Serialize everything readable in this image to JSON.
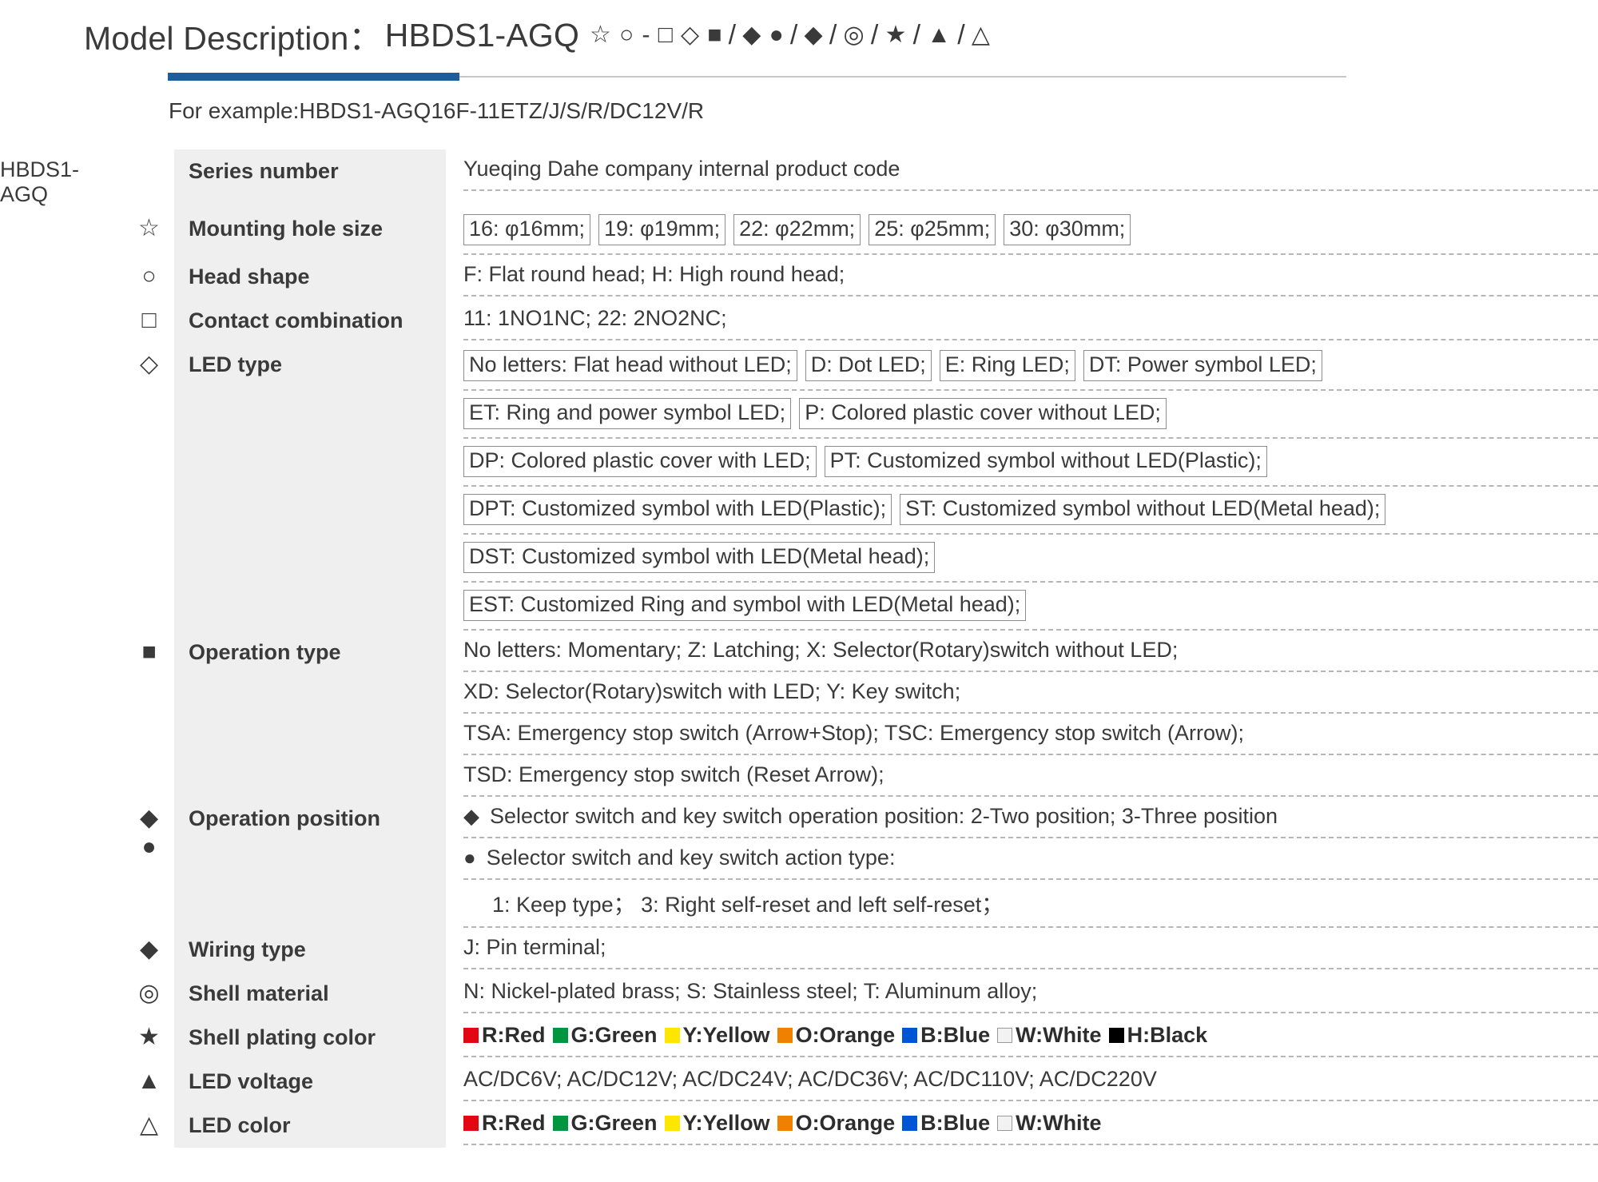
{
  "header": {
    "title_label": "Model Description：",
    "model": "HBDS1-AGQ",
    "symbol_sequence": [
      "☆",
      "○",
      "-",
      "□",
      "◇",
      "■",
      "/",
      "◆",
      "●",
      "/",
      "◆",
      "/",
      "◎",
      "/",
      "★",
      "/",
      "▲",
      "/",
      "△"
    ],
    "example": "For example:HBDS1-AGQ16F-11ETZ/J/S/R/DC12V/R",
    "accent_color": "#1d5d9b"
  },
  "table": {
    "series_code": "HBDS1-AGQ",
    "rows": [
      {
        "symbols": [],
        "label": "Series number",
        "lines": [
          {
            "boxed": false,
            "items": [
              "Yueqing Dahe company internal product code"
            ]
          }
        ]
      },
      {
        "symbols": [
          "☆"
        ],
        "label": "Mounting hole size",
        "lines": [
          {
            "boxed": true,
            "items": [
              "16: φ16mm;",
              "19: φ19mm;",
              "22: φ22mm;",
              "25: φ25mm;",
              "30: φ30mm;"
            ]
          }
        ]
      },
      {
        "symbols": [
          "○"
        ],
        "label": "Head  shape",
        "lines": [
          {
            "boxed": false,
            "items": [
              "F: Flat round head;   H: High round head;"
            ]
          }
        ]
      },
      {
        "symbols": [
          "□"
        ],
        "label": "Contact combination",
        "lines": [
          {
            "boxed": false,
            "items": [
              "11: 1NO1NC;   22: 2NO2NC;"
            ]
          }
        ]
      },
      {
        "symbols": [
          "◇"
        ],
        "label": "LED type",
        "lines": [
          {
            "boxed": true,
            "items": [
              "No letters: Flat head without LED;",
              "D: Dot LED;",
              "E: Ring LED;",
              "DT: Power symbol LED;"
            ]
          },
          {
            "boxed": true,
            "items": [
              "ET: Ring and power symbol LED;",
              "P: Colored plastic cover without LED;"
            ]
          },
          {
            "boxed": true,
            "items": [
              "DP: Colored plastic cover with LED;",
              "PT: Customized symbol without LED(Plastic);"
            ]
          },
          {
            "boxed": true,
            "items": [
              "DPT: Customized symbol with LED(Plastic);",
              "ST: Customized symbol without LED(Metal head);"
            ]
          },
          {
            "boxed": true,
            "items": [
              "DST: Customized symbol with LED(Metal head);"
            ]
          },
          {
            "boxed": true,
            "items": [
              "EST: Customized Ring and symbol with LED(Metal head);"
            ]
          }
        ]
      },
      {
        "symbols": [
          "■"
        ],
        "label": "Operation type",
        "lines": [
          {
            "boxed": false,
            "items": [
              "No letters: Momentary;   Z: Latching;   X: Selector(Rotary)switch without LED;"
            ]
          },
          {
            "boxed": false,
            "items": [
              "XD: Selector(Rotary)switch with  LED;   Y: Key switch;"
            ]
          },
          {
            "boxed": false,
            "items": [
              "TSA: Emergency stop switch (Arrow+Stop);   TSC: Emergency stop switch (Arrow);"
            ]
          },
          {
            "boxed": false,
            "items": [
              "TSD: Emergency stop switch (Reset Arrow);"
            ]
          }
        ]
      },
      {
        "symbols": [
          "◆",
          "●"
        ],
        "label": "Operation position",
        "lines": [
          {
            "boxed": false,
            "prefix": "◆",
            "items": [
              "Selector switch and key switch operation position: 2-Two position;   3-Three position"
            ]
          },
          {
            "boxed": false,
            "prefix": "●",
            "items": [
              "Selector switch and key switch action type:"
            ]
          },
          {
            "boxed": false,
            "indent": true,
            "items": [
              "1: Keep type；  3: Right self-reset and left self-reset；"
            ]
          }
        ]
      },
      {
        "symbols": [
          "◆"
        ],
        "label": "Wiring type",
        "lines": [
          {
            "boxed": false,
            "items": [
              "J: Pin terminal;"
            ]
          }
        ]
      },
      {
        "symbols": [
          "◎"
        ],
        "label": "Shell material",
        "lines": [
          {
            "boxed": false,
            "items": [
              "N: Nickel-plated brass;  S: Stainless steel;   T: Aluminum alloy;"
            ]
          }
        ]
      },
      {
        "symbols": [
          "★"
        ],
        "label": "Shell plating color",
        "swatches": [
          {
            "label": "R:Red",
            "color": "#e30613"
          },
          {
            "label": "G:Green",
            "color": "#009640"
          },
          {
            "label": "Y:Yellow",
            "color": "#ffe600"
          },
          {
            "label": "O:Orange",
            "color": "#f08000"
          },
          {
            "label": "B:Blue",
            "color": "#0055d4"
          },
          {
            "label": "W:White",
            "color": "#f2f2f2",
            "bordered": true
          },
          {
            "label": "H:Black",
            "color": "#000000"
          }
        ]
      },
      {
        "symbols": [
          "▲"
        ],
        "label": "LED voltage",
        "lines": [
          {
            "boxed": false,
            "items": [
              "AC/DC6V;   AC/DC12V;   AC/DC24V;   AC/DC36V;   AC/DC110V;   AC/DC220V"
            ]
          }
        ]
      },
      {
        "symbols": [
          "△"
        ],
        "label": "LED color",
        "swatches": [
          {
            "label": "R:Red",
            "color": "#e30613"
          },
          {
            "label": "G:Green",
            "color": "#009640"
          },
          {
            "label": "Y:Yellow",
            "color": "#ffe600"
          },
          {
            "label": "O:Orange",
            "color": "#f08000"
          },
          {
            "label": "B:Blue",
            "color": "#0055d4"
          },
          {
            "label": "W:White",
            "color": "#f2f2f2",
            "bordered": true
          }
        ]
      }
    ]
  }
}
